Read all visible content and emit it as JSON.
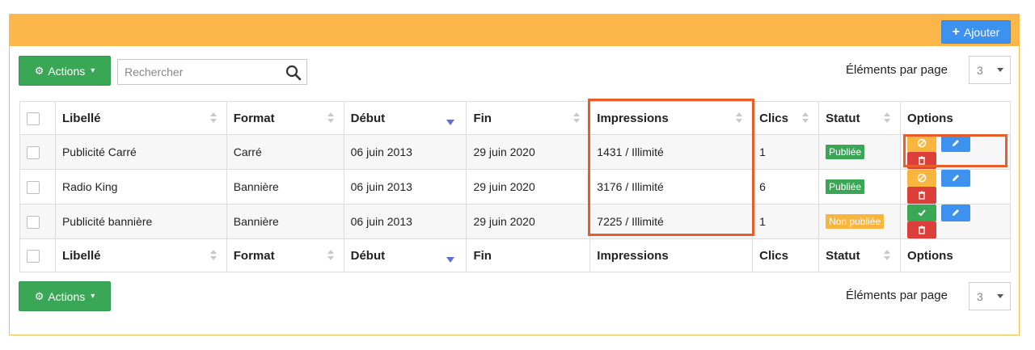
{
  "header": {
    "add_label": "Ajouter"
  },
  "toolbar": {
    "actions_label": "Actions",
    "search_placeholder": "Rechercher",
    "per_page_label": "Éléments par page",
    "per_page_value": "3"
  },
  "columns": {
    "libelle": "Libellé",
    "format": "Format",
    "debut": "Début",
    "fin": "Fin",
    "impressions": "Impressions",
    "clics": "Clics",
    "statut": "Statut",
    "options": "Options"
  },
  "rows": [
    {
      "libelle": "Publicité Carré",
      "format": "Carré",
      "debut": "06 juin 2013",
      "fin": "29 juin 2020",
      "impressions": "1431 / Illimité",
      "clics": "1",
      "statut": "Publiée",
      "statut_color": "#3aa757",
      "first_action_icon": "ban-icon"
    },
    {
      "libelle": "Radio King",
      "format": "Bannière",
      "debut": "06 juin 2013",
      "fin": "29 juin 2020",
      "impressions": "3176 / Illimité",
      "clics": "6",
      "statut": "Publiée",
      "statut_color": "#3aa757",
      "first_action_icon": "ban-icon"
    },
    {
      "libelle": "Publicité bannière",
      "format": "Bannière",
      "debut": "06 juin 2013",
      "fin": "29 juin 2020",
      "impressions": "7225 / Illimité",
      "clics": "1",
      "statut": "Non publiée",
      "statut_color": "#f9b53e",
      "first_action_icon": "check-icon"
    }
  ],
  "colors": {
    "header_bar": "#fdb64a",
    "primary": "#3c92ee",
    "success": "#3aa757",
    "warning": "#f9b53e",
    "danger": "#dc3e3a",
    "highlight": "#e85d2a"
  }
}
